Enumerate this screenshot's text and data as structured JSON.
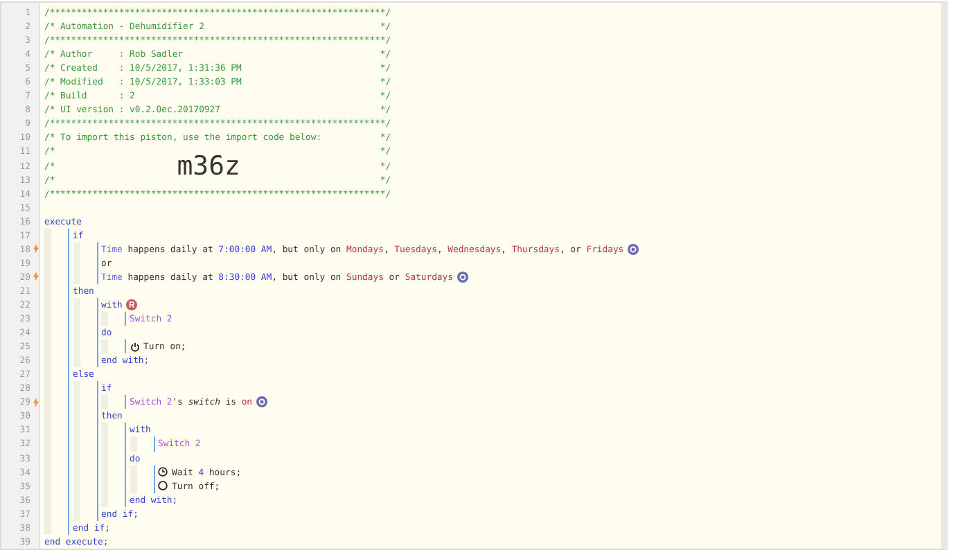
{
  "editor": {
    "lines": [
      {
        "number": "1",
        "kind": "comment",
        "trigger": false,
        "text": "/***************************************************************/"
      },
      {
        "number": "2",
        "kind": "comment",
        "trigger": false,
        "text": "/* Automation - Dehumidifier 2",
        "end": "*/"
      },
      {
        "number": "3",
        "kind": "comment",
        "trigger": false,
        "text": "/***************************************************************/"
      },
      {
        "number": "4",
        "kind": "comment",
        "trigger": false,
        "text": "/* Author     : Rob Sadler",
        "end": "*/"
      },
      {
        "number": "5",
        "kind": "comment",
        "trigger": false,
        "text": "/* Created    : 10/5/2017, 1:31:36 PM",
        "end": "*/"
      },
      {
        "number": "6",
        "kind": "comment",
        "trigger": false,
        "text": "/* Modified   : 10/5/2017, 1:33:03 PM",
        "end": "*/"
      },
      {
        "number": "7",
        "kind": "comment",
        "trigger": false,
        "text": "/* Build      : 2",
        "end": "*/"
      },
      {
        "number": "8",
        "kind": "comment",
        "trigger": false,
        "text": "/* UI version : v0.2.0ec.20170927",
        "end": "*/"
      },
      {
        "number": "9",
        "kind": "comment",
        "trigger": false,
        "text": "/***************************************************************/"
      },
      {
        "number": "10",
        "kind": "comment",
        "trigger": false,
        "text": "/* To import this piston, use the import code below:",
        "end": "*/"
      },
      {
        "number": "11",
        "kind": "comment",
        "trigger": false,
        "text": "/*",
        "end": "*/"
      },
      {
        "number": "12",
        "kind": "comment",
        "trigger": false,
        "text": "/*",
        "code": "m36z",
        "end": "*/"
      },
      {
        "number": "13",
        "kind": "comment",
        "trigger": false,
        "text": "/*",
        "end": "*/"
      },
      {
        "number": "14",
        "kind": "comment",
        "trigger": false,
        "text": "/***************************************************************/"
      },
      {
        "number": "15",
        "kind": "blank",
        "trigger": false
      },
      {
        "number": "16",
        "kind": "code",
        "trigger": false,
        "tokens": [
          {
            "kind": "keyword",
            "text": "execute"
          }
        ],
        "children": [
          {
            "number": "17",
            "kind": "code",
            "trigger": false,
            "tokens": [
              {
                "kind": "keyword",
                "text": "if"
              }
            ],
            "children": [
              {
                "number": "18",
                "kind": "code",
                "trigger": true,
                "tokens": [
                  {
                    "kind": "subject",
                    "text": "Time"
                  },
                  {
                    "kind": "plain",
                    "text": " happens daily at "
                  },
                  {
                    "kind": "value",
                    "text": "7:00:00 AM"
                  },
                  {
                    "kind": "plain",
                    "text": ", but only on "
                  },
                  {
                    "kind": "day",
                    "text": "Mondays"
                  },
                  {
                    "kind": "plain",
                    "text": ", "
                  },
                  {
                    "kind": "day",
                    "text": "Tuesdays"
                  },
                  {
                    "kind": "plain",
                    "text": ", "
                  },
                  {
                    "kind": "day",
                    "text": "Wednesdays"
                  },
                  {
                    "kind": "plain",
                    "text": ", "
                  },
                  {
                    "kind": "day",
                    "text": "Thursdays"
                  },
                  {
                    "kind": "plain",
                    "text": ", or "
                  },
                  {
                    "kind": "day",
                    "text": "Fridays"
                  },
                  {
                    "kind": "add"
                  }
                ]
              },
              {
                "number": "19",
                "kind": "code",
                "trigger": false,
                "tokens": [
                  {
                    "kind": "plain",
                    "text": "or"
                  }
                ]
              },
              {
                "number": "20",
                "kind": "code",
                "trigger": true,
                "tokens": [
                  {
                    "kind": "subject",
                    "text": "Time"
                  },
                  {
                    "kind": "plain",
                    "text": " happens daily at "
                  },
                  {
                    "kind": "value",
                    "text": "8:30:00 AM"
                  },
                  {
                    "kind": "plain",
                    "text": ", but only on "
                  },
                  {
                    "kind": "day",
                    "text": "Sundays"
                  },
                  {
                    "kind": "plain",
                    "text": " or "
                  },
                  {
                    "kind": "day",
                    "text": "Saturdays"
                  },
                  {
                    "kind": "add"
                  }
                ]
              }
            ]
          },
          {
            "number": "21",
            "kind": "code",
            "trigger": false,
            "tokens": [
              {
                "kind": "keyword",
                "text": "then"
              }
            ],
            "children": [
              {
                "number": "22",
                "kind": "code",
                "trigger": false,
                "tokens": [
                  {
                    "kind": "keyword",
                    "text": "with"
                  },
                  {
                    "kind": "restriction"
                  }
                ],
                "children": [
                  {
                    "number": "23",
                    "kind": "code",
                    "trigger": false,
                    "tokens": [
                      {
                        "kind": "device",
                        "text": "Switch 2"
                      }
                    ]
                  }
                ]
              },
              {
                "number": "24",
                "kind": "code",
                "trigger": false,
                "tokens": [
                  {
                    "kind": "keyword",
                    "text": "do"
                  }
                ],
                "children": [
                  {
                    "number": "25",
                    "kind": "code",
                    "trigger": false,
                    "tokens": [
                      {
                        "kind": "power"
                      },
                      {
                        "kind": "plain",
                        "text": "Turn on;"
                      }
                    ]
                  }
                ]
              },
              {
                "number": "26",
                "kind": "code",
                "trigger": false,
                "tokens": [
                  {
                    "kind": "keyword",
                    "text": "end with;"
                  }
                ]
              }
            ]
          },
          {
            "number": "27",
            "kind": "code",
            "trigger": false,
            "tokens": [
              {
                "kind": "keyword",
                "text": "else"
              }
            ],
            "children": [
              {
                "number": "28",
                "kind": "code",
                "trigger": false,
                "tokens": [
                  {
                    "kind": "keyword",
                    "text": "if"
                  }
                ],
                "children": [
                  {
                    "number": "29",
                    "kind": "code",
                    "trigger": true,
                    "tokens": [
                      {
                        "kind": "device",
                        "text": "Switch 2"
                      },
                      {
                        "kind": "plain",
                        "text": "'s "
                      },
                      {
                        "kind": "attribute",
                        "text": "switch"
                      },
                      {
                        "kind": "plain",
                        "text": " is "
                      },
                      {
                        "kind": "day",
                        "text": "on"
                      },
                      {
                        "kind": "add"
                      }
                    ]
                  }
                ]
              },
              {
                "number": "30",
                "kind": "code",
                "trigger": false,
                "tokens": [
                  {
                    "kind": "keyword",
                    "text": "then"
                  }
                ],
                "children": [
                  {
                    "number": "31",
                    "kind": "code",
                    "trigger": false,
                    "tokens": [
                      {
                        "kind": "keyword",
                        "text": "with"
                      }
                    ],
                    "children": [
                      {
                        "number": "32",
                        "kind": "code",
                        "trigger": false,
                        "tokens": [
                          {
                            "kind": "device",
                            "text": "Switch 2"
                          }
                        ]
                      }
                    ]
                  },
                  {
                    "number": "33",
                    "kind": "code",
                    "trigger": false,
                    "tokens": [
                      {
                        "kind": "keyword",
                        "text": "do"
                      }
                    ],
                    "children": [
                      {
                        "number": "34",
                        "kind": "code",
                        "trigger": false,
                        "tokens": [
                          {
                            "kind": "clock"
                          },
                          {
                            "kind": "plain",
                            "text": "Wait "
                          },
                          {
                            "kind": "value",
                            "text": "4"
                          },
                          {
                            "kind": "plain",
                            "text": " hours;"
                          }
                        ]
                      },
                      {
                        "number": "35",
                        "kind": "code",
                        "trigger": false,
                        "tokens": [
                          {
                            "kind": "circle"
                          },
                          {
                            "kind": "plain",
                            "text": "Turn off;"
                          }
                        ]
                      }
                    ]
                  },
                  {
                    "number": "36",
                    "kind": "code",
                    "trigger": false,
                    "tokens": [
                      {
                        "kind": "keyword",
                        "text": "end with;"
                      }
                    ]
                  }
                ]
              },
              {
                "number": "37",
                "kind": "code",
                "trigger": false,
                "tokens": [
                  {
                    "kind": "keyword",
                    "text": "end if;"
                  }
                ]
              }
            ]
          },
          {
            "number": "38",
            "kind": "code",
            "trigger": false,
            "tokens": [
              {
                "kind": "keyword",
                "text": "end if;"
              }
            ]
          }
        ]
      },
      {
        "number": "39",
        "kind": "code",
        "trigger": false,
        "tokens": [
          {
            "kind": "keyword",
            "text": "end execute;"
          }
        ]
      }
    ]
  }
}
